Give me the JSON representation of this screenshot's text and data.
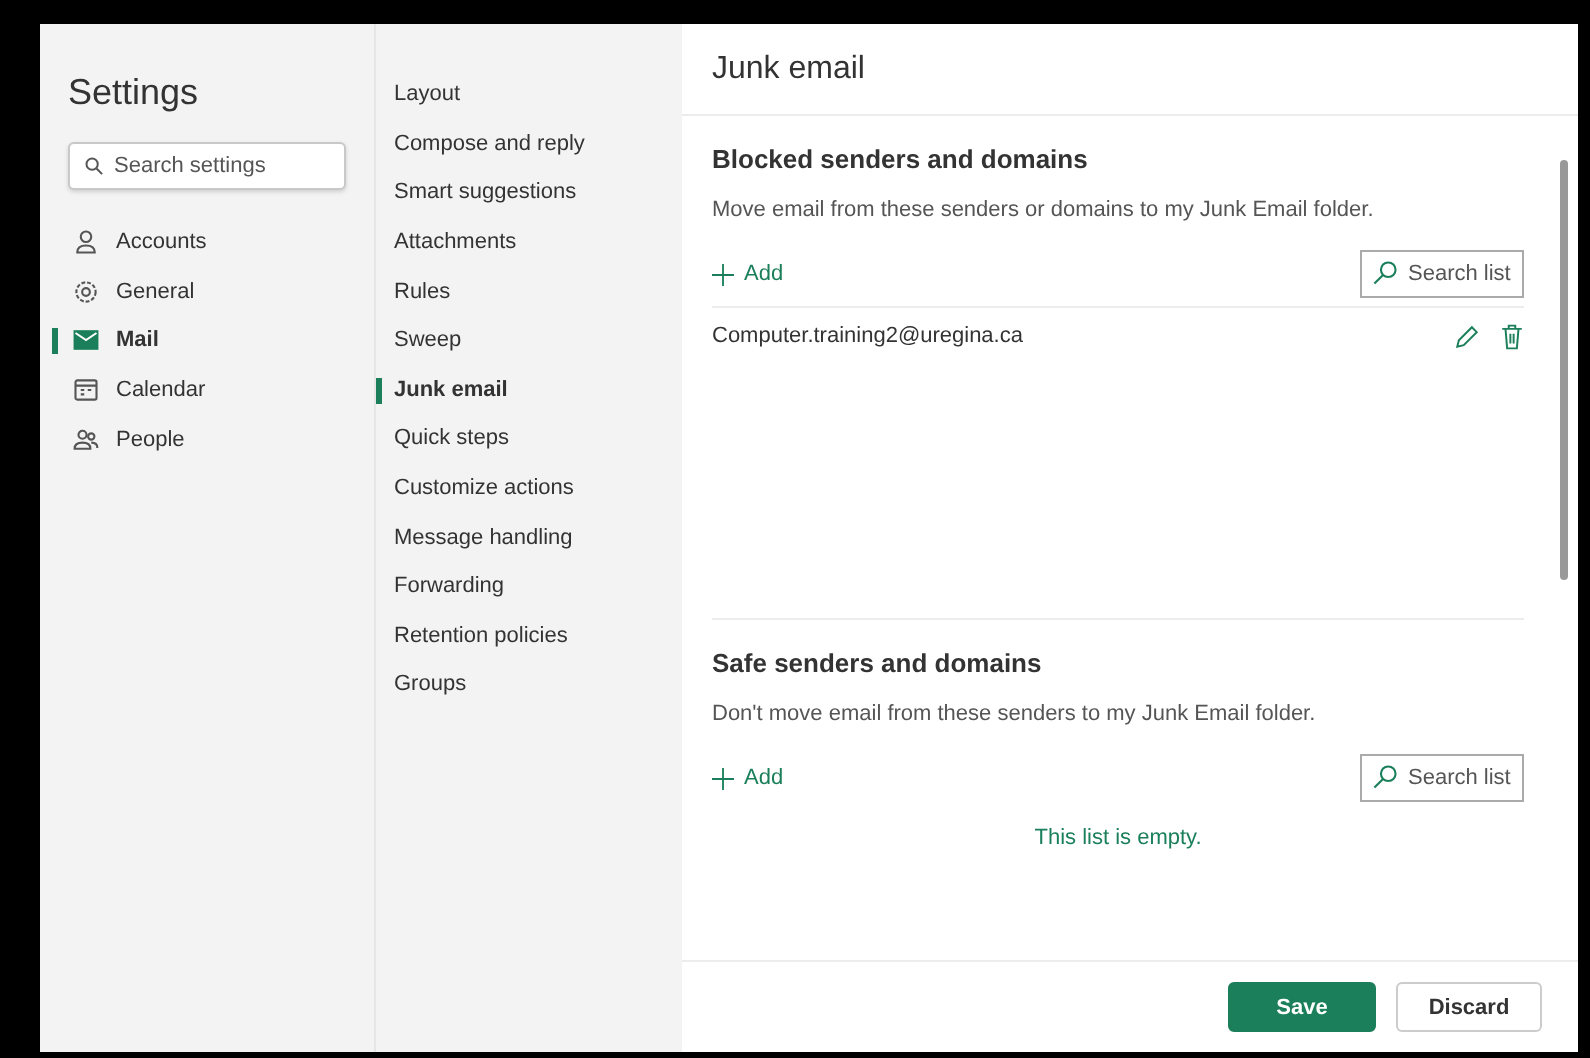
{
  "sidebar": {
    "title": "Settings",
    "search": {
      "placeholder": "Search settings"
    },
    "items": [
      {
        "label": "Accounts",
        "selected": false
      },
      {
        "label": "General",
        "selected": false
      },
      {
        "label": "Mail",
        "selected": true
      },
      {
        "label": "Calendar",
        "selected": false
      },
      {
        "label": "People",
        "selected": false
      }
    ]
  },
  "subnav": {
    "items": [
      {
        "label": "Layout",
        "selected": false
      },
      {
        "label": "Compose and reply",
        "selected": false
      },
      {
        "label": "Smart suggestions",
        "selected": false
      },
      {
        "label": "Attachments",
        "selected": false
      },
      {
        "label": "Rules",
        "selected": false
      },
      {
        "label": "Sweep",
        "selected": false
      },
      {
        "label": "Junk email",
        "selected": true
      },
      {
        "label": "Quick steps",
        "selected": false
      },
      {
        "label": "Customize actions",
        "selected": false
      },
      {
        "label": "Message handling",
        "selected": false
      },
      {
        "label": "Forwarding",
        "selected": false
      },
      {
        "label": "Retention policies",
        "selected": false
      },
      {
        "label": "Groups",
        "selected": false
      }
    ]
  },
  "content": {
    "title": "Junk email",
    "sections": [
      {
        "heading": "Blocked senders and domains",
        "description": "Move email from these senders or domains to my Junk Email folder.",
        "add": "Add",
        "search": {
          "placeholder": "Search list"
        },
        "entries": [
          "Computer.training2@uregina.ca"
        ]
      },
      {
        "heading": "Safe senders and domains",
        "description": "Don't move email from these senders to my Junk Email folder.",
        "add": "Add",
        "search": {
          "placeholder": "Search list"
        },
        "empty": "This list is empty."
      }
    ],
    "buttons": [
      {
        "label": "Save",
        "kind": "primary"
      },
      {
        "label": "Discard",
        "kind": "secondary"
      }
    ]
  }
}
